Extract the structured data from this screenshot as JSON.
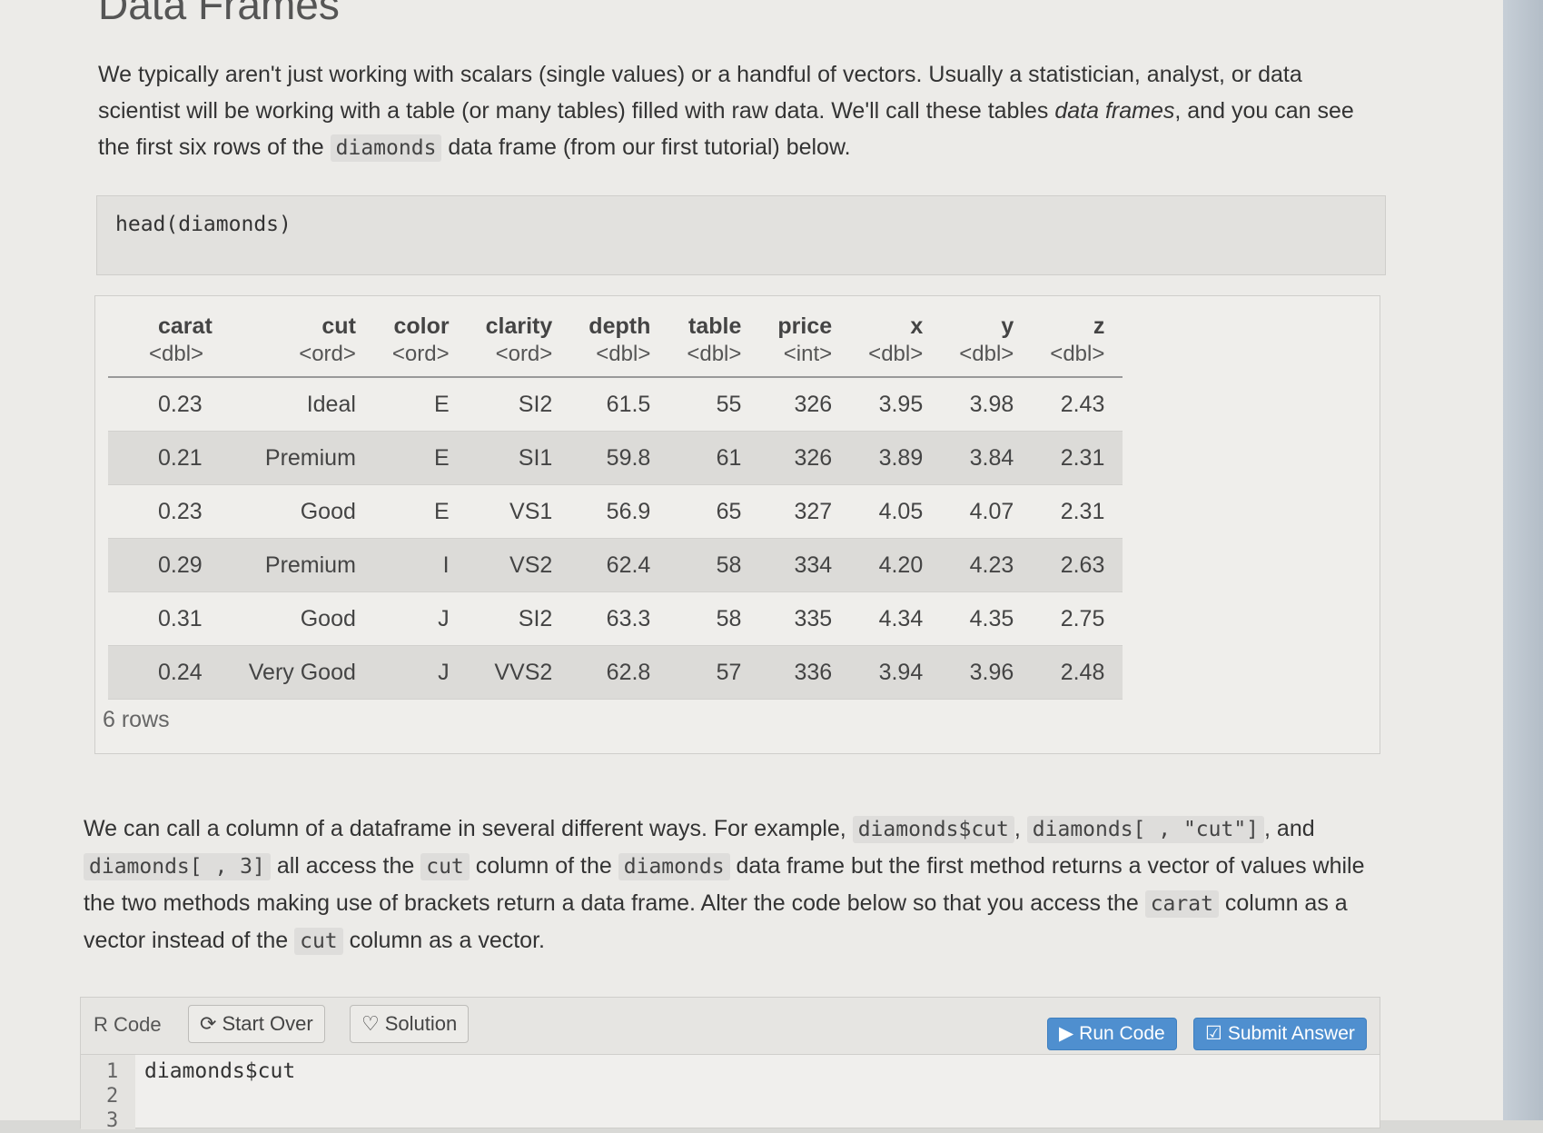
{
  "heading": "Data Frames",
  "intro": {
    "part1": "We typically aren't just working with scalars (single values) or a handful of vectors. Usually a statistician, analyst, or data scientist will be working with a table (or many tables) filled with raw data. We'll call these tables ",
    "em": "data frames",
    "part2": ", and you can see the first six rows of the ",
    "code": "diamonds",
    "part3": " data frame (from our first tutorial) below."
  },
  "code_block": "head(diamonds)",
  "dataframe": {
    "columns": [
      {
        "name": "carat",
        "type": "<dbl>"
      },
      {
        "name": "cut",
        "type": "<ord>"
      },
      {
        "name": "color",
        "type": "<ord>"
      },
      {
        "name": "clarity",
        "type": "<ord>"
      },
      {
        "name": "depth",
        "type": "<dbl>"
      },
      {
        "name": "table",
        "type": "<dbl>"
      },
      {
        "name": "price",
        "type": "<int>"
      },
      {
        "name": "x",
        "type": "<dbl>"
      },
      {
        "name": "y",
        "type": "<dbl>"
      },
      {
        "name": "z",
        "type": "<dbl>"
      }
    ],
    "rows": [
      [
        "0.23",
        "Ideal",
        "E",
        "SI2",
        "61.5",
        "55",
        "326",
        "3.95",
        "3.98",
        "2.43"
      ],
      [
        "0.21",
        "Premium",
        "E",
        "SI1",
        "59.8",
        "61",
        "326",
        "3.89",
        "3.84",
        "2.31"
      ],
      [
        "0.23",
        "Good",
        "E",
        "VS1",
        "56.9",
        "65",
        "327",
        "4.05",
        "4.07",
        "2.31"
      ],
      [
        "0.29",
        "Premium",
        "I",
        "VS2",
        "62.4",
        "58",
        "334",
        "4.20",
        "4.23",
        "2.63"
      ],
      [
        "0.31",
        "Good",
        "J",
        "SI2",
        "63.3",
        "58",
        "335",
        "4.34",
        "4.35",
        "2.75"
      ],
      [
        "0.24",
        "Very Good",
        "J",
        "VVS2",
        "62.8",
        "57",
        "336",
        "3.94",
        "3.96",
        "2.48"
      ]
    ],
    "row_count": "6 rows"
  },
  "para2": {
    "t1": "We can call a column of a dataframe in several different ways. For example, ",
    "c1": "diamonds$cut",
    "t2": ", ",
    "c2": "diamonds[ , \"cut\"]",
    "t3": ", and ",
    "c3": "diamonds[ , 3]",
    "t4": " all access the ",
    "c4": "cut",
    "t5": " column of the ",
    "c5": "diamonds",
    "t6": " data frame but the first method returns a vector of values while the two methods making use of brackets return a data frame. Alter the code below so that you access the ",
    "c6": "carat",
    "t7": " column as a vector instead of the ",
    "c7": "cut",
    "t8": " column as a vector."
  },
  "editor": {
    "label": "R Code",
    "start_over": "Start Over",
    "solution": "Solution",
    "run": "Run Code",
    "submit": "Submit Answer",
    "line_numbers": [
      "1",
      "2",
      "3"
    ],
    "code": "diamonds$cut"
  },
  "colors": {
    "accent_button": "#4f8fcf"
  }
}
